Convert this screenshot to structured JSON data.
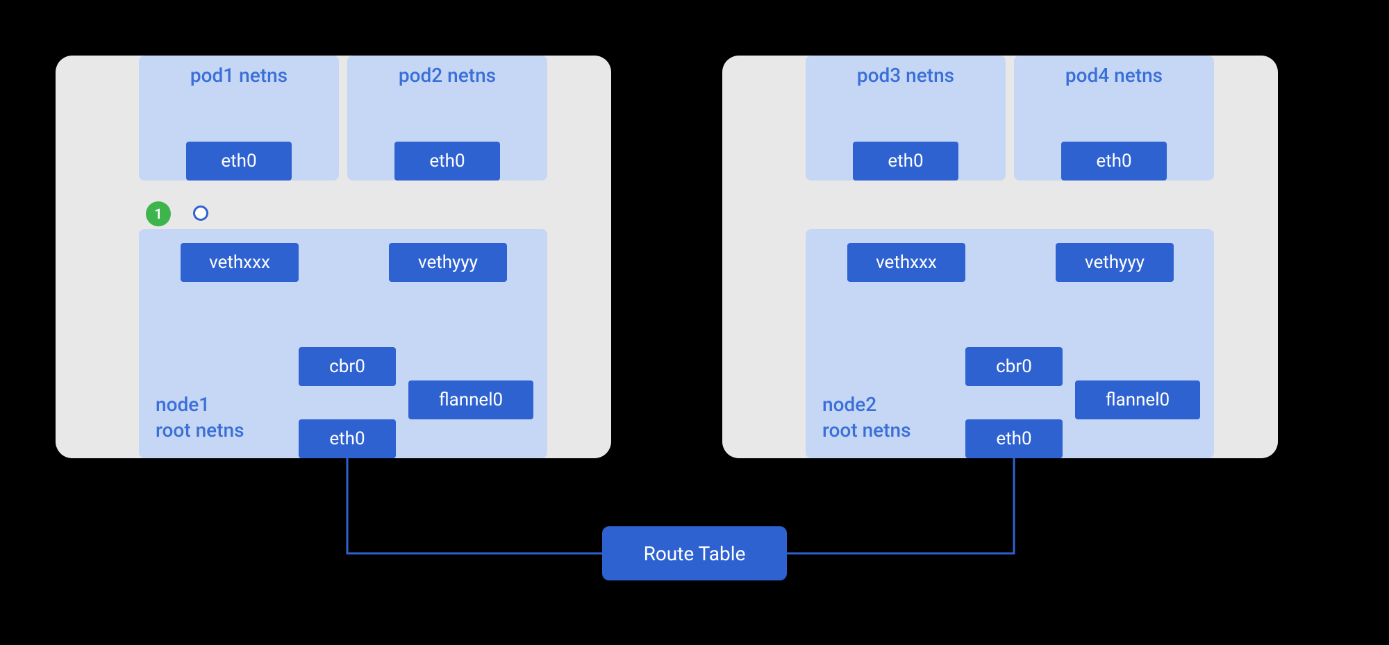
{
  "nodes": [
    {
      "root_label": "node1\nroot netns",
      "pods": [
        {
          "label": "pod1 netns",
          "eth": "eth0",
          "veth": "vethxxx"
        },
        {
          "label": "pod2 netns",
          "eth": "eth0",
          "veth": "vethyyy"
        }
      ],
      "cbr": "cbr0",
      "flannel": "flannel0",
      "eth_root": "eth0"
    },
    {
      "root_label": "node2\nroot netns",
      "pods": [
        {
          "label": "pod3 netns",
          "eth": "eth0",
          "veth": "vethxxx"
        },
        {
          "label": "pod4 netns",
          "eth": "eth0",
          "veth": "vethyyy"
        }
      ],
      "cbr": "cbr0",
      "flannel": "flannel0",
      "eth_root": "eth0"
    }
  ],
  "route_table": "Route Table",
  "annotation": {
    "number": "1"
  },
  "colors": {
    "card_bg": "#e8e8e8",
    "netns_bg": "#c5d7f4",
    "iface_bg": "#2f62d1",
    "accent_green": "#3db44c",
    "label_blue": "#3a6fd8"
  }
}
